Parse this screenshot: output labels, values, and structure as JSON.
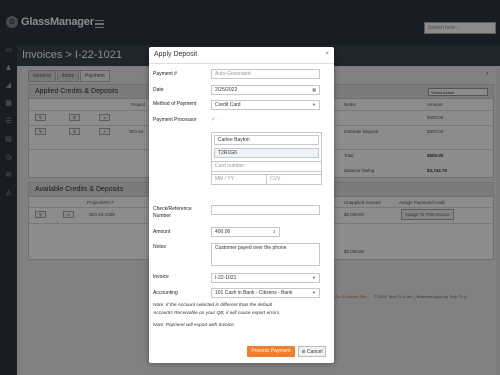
{
  "app": {
    "logo_glyph": "G",
    "name": "GlassManager",
    "search_placeholder": "Search here...."
  },
  "page": {
    "title": "Invoices > I-22-1021"
  },
  "tabs": [
    {
      "label": "General"
    },
    {
      "label": "Items"
    },
    {
      "label": "Payment"
    }
  ],
  "applied": {
    "title": "Applied Credits & Deposits",
    "select_action": "Select Action",
    "col_project": "Project",
    "col_notes": "Notes",
    "col_amount": "Amount",
    "row1": {
      "amount": "$400.00"
    },
    "row2": {
      "project": "WO-22-",
      "notes": "Estimate Deposit",
      "amount": "$300.00"
    },
    "total_label": "Total",
    "total_value": "$500.00",
    "balance_label": "Balance Owing",
    "balance_value": "$3,743.79"
  },
  "available": {
    "title": "Available Credits & Deposits",
    "col_project": "Project/WO #",
    "col_unapplied": "Unapplied Amount",
    "col_assign": "Assign Payment/Credit",
    "row1": {
      "project": "WO-22-1028",
      "unapplied": "$2,000.00",
      "assign_label": "Assign To This Invoice"
    },
    "row2": {
      "unapplied": "$2,000.00"
    }
  },
  "footer": {
    "mobile_link": "Go To Mobile Site",
    "copyright": "© 2022 Tech To U Inc. | Business Apps by Tech To U"
  },
  "modal": {
    "title": "Apply Deposit",
    "close": "×",
    "payment_no_label": "Payment #",
    "payment_no_placeholder": "Auto-Generated",
    "date_label": "Date",
    "date_value": "2/25/2022",
    "method_label": "Method of Payment",
    "method_value": "Credit Card",
    "processor_label": "Payment Processor",
    "processor_checked": "✓",
    "card_name": "Carlee Bayton",
    "card_postal": "T2R1G6",
    "card_number_placeholder": "Card number",
    "card_expiry_placeholder": "MM / YY",
    "card_cvv_placeholder": "CVV",
    "check_label_line1": "Check/Reference",
    "check_label_line2": "Number",
    "amount_label": "Amount",
    "amount_value": "400.00",
    "notes_label": "Notes",
    "notes_value": "Customer payed over the phone",
    "invoice_label": "Invoice",
    "invoice_value": "I-22-1021",
    "accounting_label": "Accounting",
    "accounting_value": "101 Cash in Bank - Citizens - Bank",
    "note1_line1": "Note: If the Account selected is different than the default",
    "note1_line2": "Accounts Receivable on your QB, it will cause export errors.",
    "note2": "Note: Payment will export with Invoice",
    "process_button": "Process Payment",
    "cancel_button": "Cancel"
  },
  "colors": {
    "accent": "#f07e2a",
    "nav": "#2d3641"
  }
}
